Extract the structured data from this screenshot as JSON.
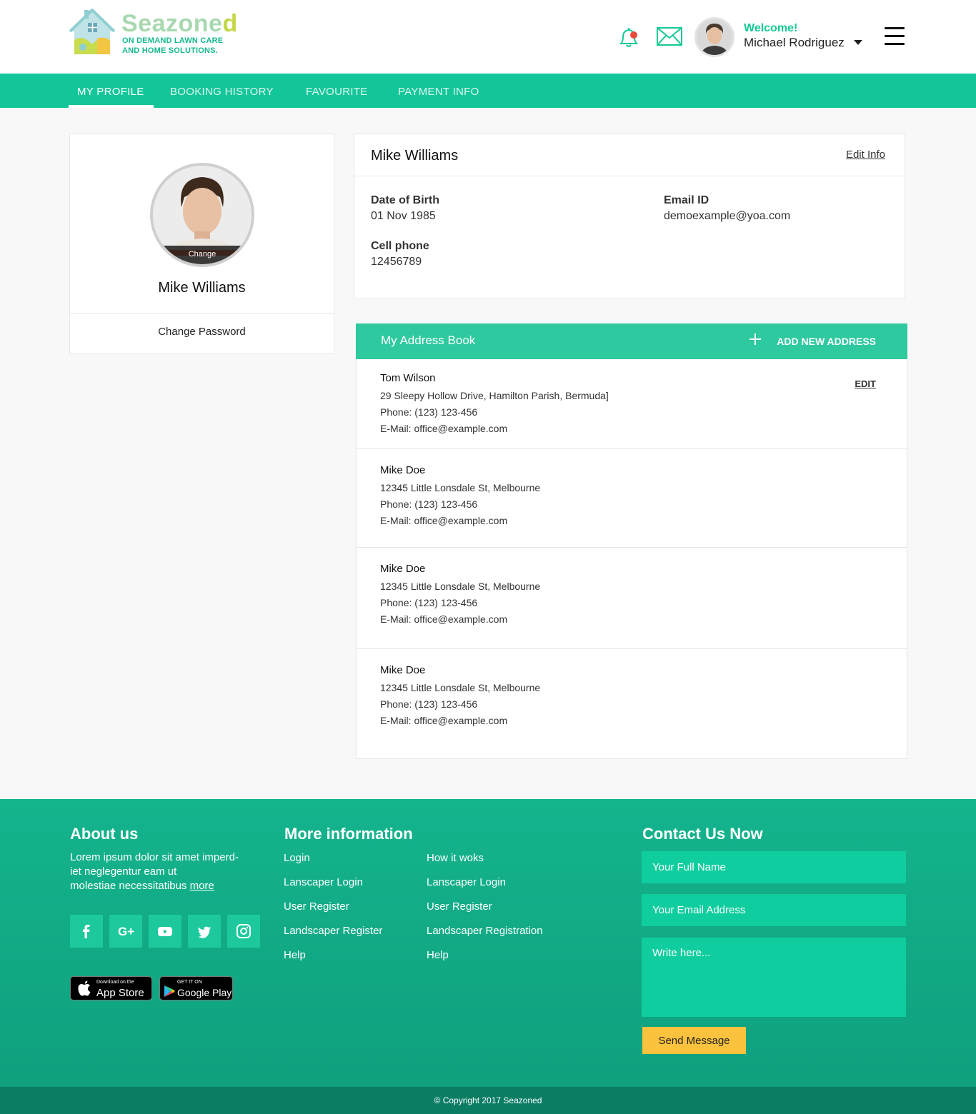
{
  "brand": {
    "name_part1": "Seazone",
    "name_part2": "d",
    "tagline_line1": "ON DEMAND LAWN CARE",
    "tagline_line2": "AND HOME SOLUTIONS."
  },
  "header": {
    "welcome": "Welcome!",
    "user_name": "Michael Rodriguez",
    "notification_dot_color": "#e74c3c",
    "accent_color": "#14c896"
  },
  "tabs": [
    {
      "label": "MY PROFILE",
      "active": true
    },
    {
      "label": "BOOKING HISTORY",
      "active": false
    },
    {
      "label": "FAVOURITE",
      "active": false
    },
    {
      "label": "PAYMENT INFO",
      "active": false
    }
  ],
  "profile": {
    "change_label": "Change",
    "name": "Mike Williams",
    "change_password": "Change Password"
  },
  "info": {
    "title": "Mike Williams",
    "edit_label": "Edit Info",
    "dob_label": "Date of Birth",
    "dob_value": "01 Nov 1985",
    "email_label": "Email ID",
    "email_value": "demoexample@yoa.com",
    "phone_label": "Cell phone",
    "phone_value": "12456789"
  },
  "address_book": {
    "title": "My Address Book",
    "add_label": "ADD NEW ADDRESS",
    "edit_label": "EDIT",
    "items": [
      {
        "name": "Tom Wilson",
        "address": "29 Sleepy Hollow Drive, Hamilton Parish, Bermuda]",
        "phone": "Phone: (123) 123-456",
        "email": "E-Mail: office@example.com"
      },
      {
        "name": "Mike Doe",
        "address": "12345 Little Lonsdale St, Melbourne",
        "phone": "Phone: (123) 123-456",
        "email": "E-Mail: office@example.com"
      },
      {
        "name": "Mike Doe",
        "address": "12345 Little Lonsdale St, Melbourne",
        "phone": "Phone: (123) 123-456",
        "email": "E-Mail: office@example.com"
      },
      {
        "name": "Mike Doe",
        "address": "12345 Little Lonsdale St, Melbourne",
        "phone": "Phone: (123) 123-456",
        "email": "E-Mail: office@example.com"
      }
    ]
  },
  "footer": {
    "about_title": "About us",
    "about_line1": "Lorem ipsum dolor sit amet imperd-",
    "about_line2": "iet neglegentur eam ut",
    "about_line3": "molestiae necessitatibus",
    "about_more": "more",
    "social_icons": [
      "facebook-icon",
      "google-plus-icon",
      "youtube-icon",
      "twitter-icon",
      "instagram-icon"
    ],
    "app_store_small": "Download on the",
    "app_store_big": "App Store",
    "google_play_small": "GET IT ON",
    "google_play_big": "Google Play",
    "more_title": "More information",
    "links_col1": [
      "Login",
      "Lanscaper Login",
      "User Register",
      "Landscaper Register",
      "Help"
    ],
    "links_col2": [
      "How it woks",
      "Lanscaper Login",
      "User Register",
      "Landscaper Registration",
      "Help"
    ],
    "contact_title": "Contact Us Now",
    "name_placeholder": "Your Full Name",
    "email_placeholder": "Your Email Address",
    "message_placeholder": "Write here...",
    "send_label": "Send Message",
    "copyright": "© Copyright 2017 Seazoned"
  }
}
